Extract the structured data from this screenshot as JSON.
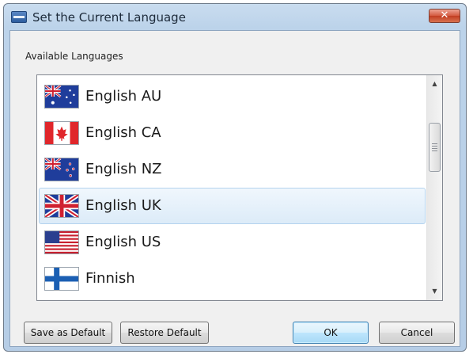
{
  "window": {
    "title": "Set the Current Language",
    "close_glyph": "✕"
  },
  "languages_group": {
    "label": "Available Languages",
    "selected_index": 3,
    "items": [
      {
        "label": "English AU",
        "flag": "australia-flag"
      },
      {
        "label": "English CA",
        "flag": "canada-flag"
      },
      {
        "label": "English NZ",
        "flag": "new-zealand-flag"
      },
      {
        "label": "English UK",
        "flag": "united-kingdom-flag"
      },
      {
        "label": "English US",
        "flag": "united-states-flag"
      },
      {
        "label": "Finnish",
        "flag": "finland-flag"
      }
    ]
  },
  "scrollbar": {
    "up_glyph": "▲",
    "down_glyph": "▼"
  },
  "buttons": {
    "save_default": "Save as Default",
    "restore_default": "Restore Default",
    "ok": "OK",
    "cancel": "Cancel"
  },
  "colors": {
    "title_bar": "#bcd3ea",
    "selection": "#dcebf8",
    "close_button": "#c23e22",
    "default_button": "#bee6fd"
  }
}
